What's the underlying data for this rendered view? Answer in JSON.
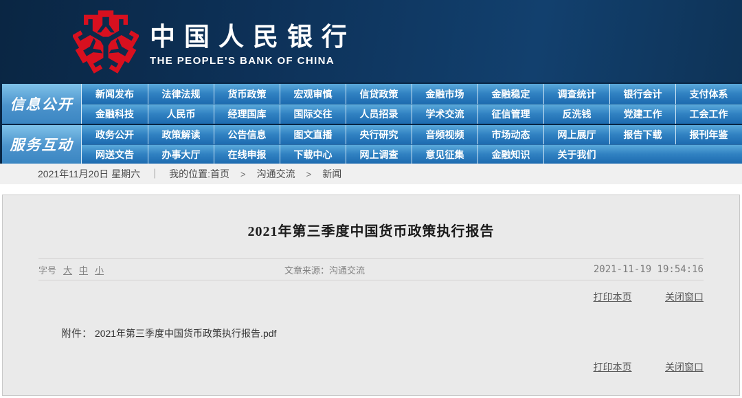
{
  "colors": {
    "brand_red": "#d8101f",
    "banner_navy": "#0d3158",
    "nav_blue_top": "#5aa9db",
    "nav_blue_bottom": "#1d6bb0",
    "nav_head_blue": "#4b93cc",
    "panel_bg": "#eaeaea",
    "link_gray": "#5a5a5a"
  },
  "header": {
    "brand_cn": "中国人民银行",
    "brand_en": "THE PEOPLE'S BANK OF CHINA"
  },
  "nav": {
    "sections": [
      {
        "label": "信息公开",
        "rows": [
          [
            "新闻发布",
            "法律法规",
            "货币政策",
            "宏观审慎",
            "信贷政策",
            "金融市场",
            "金融稳定",
            "调查统计",
            "银行会计",
            "支付体系"
          ],
          [
            "金融科技",
            "人民币",
            "经理国库",
            "国际交往",
            "人员招录",
            "学术交流",
            "征信管理",
            "反洗钱",
            "党建工作",
            "工会工作"
          ]
        ]
      },
      {
        "label": "服务互动",
        "rows": [
          [
            "政务公开",
            "政策解读",
            "公告信息",
            "图文直播",
            "央行研究",
            "音频视频",
            "市场动态",
            "网上展厅",
            "报告下载",
            "报刊年鉴"
          ],
          [
            "网送文告",
            "办事大厅",
            "在线申报",
            "下载中心",
            "网上调查",
            "意见征集",
            "金融知识",
            "关于我们"
          ]
        ]
      }
    ]
  },
  "breadcrumb": {
    "date": "2021年11月20日 星期六",
    "divider": "｜",
    "location_label": "我的位置:首页",
    "separator": ">",
    "path": [
      "沟通交流",
      "新闻"
    ]
  },
  "article": {
    "title": "2021年第三季度中国货币政策执行报告",
    "font_size_label": "字号",
    "font_sizes": [
      "大",
      "中",
      "小"
    ],
    "source_label": "文章来源：沟通交流",
    "timestamp": "2021-11-19 19:54:16",
    "print_label": "打印本页",
    "close_label": "关闭窗口",
    "attachment_label": "附件：",
    "attachment_file": "2021年第三季度中国货币政策执行报告.pdf"
  }
}
